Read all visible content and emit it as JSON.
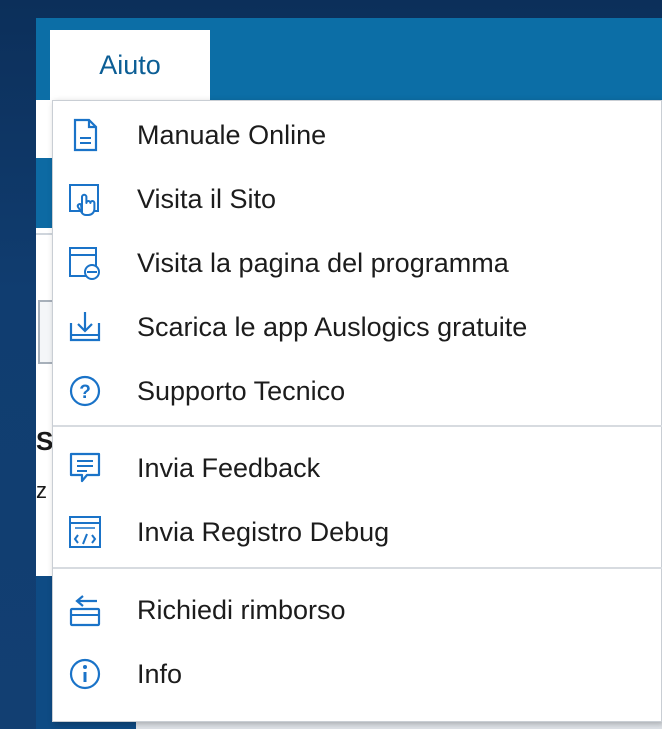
{
  "menubar": {
    "active_tab": "Aiuto"
  },
  "background_peek": {
    "char_s": "S",
    "char_z": "z"
  },
  "menu": {
    "items": [
      {
        "label": "Manuale Online",
        "icon": "document-icon"
      },
      {
        "label": "Visita il Sito",
        "icon": "hand-pointer-icon"
      },
      {
        "label": "Visita la pagina del programma",
        "icon": "browser-page-icon"
      },
      {
        "label": "Scarica le app Auslogics gratuite",
        "icon": "download-icon"
      },
      {
        "label": "Supporto Tecnico",
        "icon": "question-icon"
      },
      {
        "label": "Invia Feedback",
        "icon": "feedback-icon"
      },
      {
        "label": "Invia Registro Debug",
        "icon": "debug-log-icon"
      },
      {
        "label": "Richiedi rimborso",
        "icon": "refund-icon"
      },
      {
        "label": "Info",
        "icon": "info-icon"
      }
    ]
  },
  "colors": {
    "menubar": "#0c6ea6",
    "icon_accent": "#1a73c8",
    "menu_bg": "#ffffff",
    "backdrop": "#0f3a6b"
  }
}
